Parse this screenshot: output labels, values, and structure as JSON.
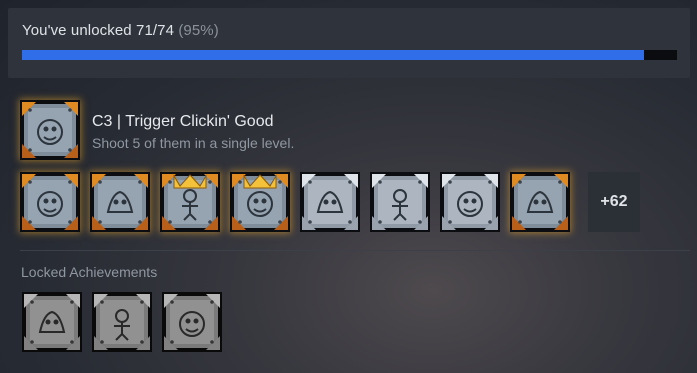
{
  "progress": {
    "label": "You've unlocked 71/74",
    "percent_label": "(95%)",
    "fraction": 0.95
  },
  "recent": {
    "title": "C3 | Trigger Clickin' Good",
    "description": "Shoot 5 of them in a single level.",
    "icon": "crate-target-icon"
  },
  "unlocked": {
    "more_label": "+62",
    "items": [
      {
        "icon": "crate-skull-icon",
        "frame": "gold"
      },
      {
        "icon": "crate-pirate-icon",
        "frame": "gold"
      },
      {
        "icon": "crate-crown-icon",
        "frame": "crown"
      },
      {
        "icon": "crate-ankh-icon",
        "frame": "crown"
      },
      {
        "icon": "crate-figure-icon",
        "frame": "silver"
      },
      {
        "icon": "crate-dancer-icon",
        "frame": "silver"
      },
      {
        "icon": "crate-creature-icon",
        "frame": "silver"
      },
      {
        "icon": "crate-bandicoot-icon",
        "frame": "gold"
      }
    ]
  },
  "locked": {
    "header": "Locked Achievements",
    "items": [
      {
        "icon": "crate-helmet-icon"
      },
      {
        "icon": "crate-wolf-icon"
      },
      {
        "icon": "crate-mask-icon"
      }
    ]
  },
  "colors": {
    "accent": "#2f6ee8",
    "gold_glow": "#f0aa28",
    "card_bg": "#2f333b"
  }
}
